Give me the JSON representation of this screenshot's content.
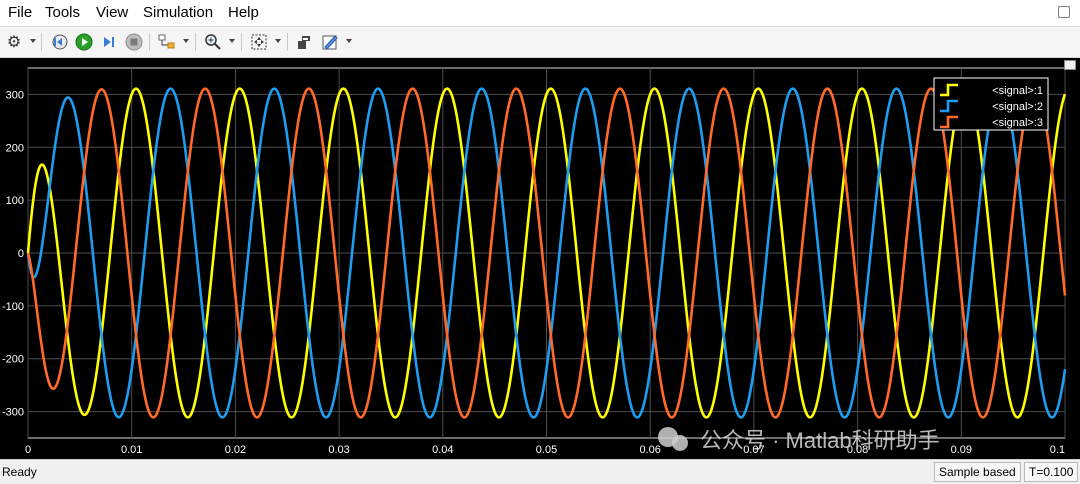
{
  "menu": [
    "File",
    "Tools",
    "View",
    "Simulation",
    "Help"
  ],
  "toolbar": {
    "icons": [
      "gear-icon",
      "step-back-icon",
      "run-icon",
      "step-forward-icon",
      "stop-icon",
      "highlight-icon",
      "zoom-icon",
      "fit-to-view-icon",
      "cursor-measure-icon",
      "style-icon"
    ]
  },
  "status": {
    "left": "Ready",
    "mode": "Sample based",
    "time": "T=0.100"
  },
  "watermark": "公众号 · Matlab科研助手",
  "colors": {
    "background": "#000000",
    "grid": "#4d4d4d",
    "axis_text": "#ffffff",
    "series": [
      "#ffff00",
      "#1e9cf0",
      "#ff6a2a"
    ]
  },
  "chart_data": {
    "type": "line",
    "title": "",
    "xlabel": "",
    "ylabel": "",
    "xlim": [
      0,
      0.1
    ],
    "ylim": [
      -350,
      350
    ],
    "x_ticks": [
      0,
      0.01,
      0.02,
      0.03,
      0.04,
      0.05,
      0.06,
      0.07,
      0.08,
      0.09,
      0.1
    ],
    "x_tick_labels": [
      "0",
      "0.01",
      "0.02",
      "0.03",
      "0.04",
      "0.05",
      "0.06",
      "0.07",
      "0.08",
      "0.09",
      "0.1"
    ],
    "y_ticks": [
      -300,
      -200,
      -100,
      0,
      100,
      200,
      300
    ],
    "y_tick_labels": [
      "-300",
      "-200",
      "-100",
      "0",
      "100",
      "200",
      "300"
    ],
    "grid": true,
    "legend_position": "top-right",
    "frequency_hz": 100,
    "amplitude": 311,
    "series": [
      {
        "name": "<signal>:1",
        "phase_deg": 75
      },
      {
        "name": "<signal>:2",
        "phase_deg": -45
      },
      {
        "name": "<signal>:3",
        "phase_deg": -165
      }
    ]
  }
}
